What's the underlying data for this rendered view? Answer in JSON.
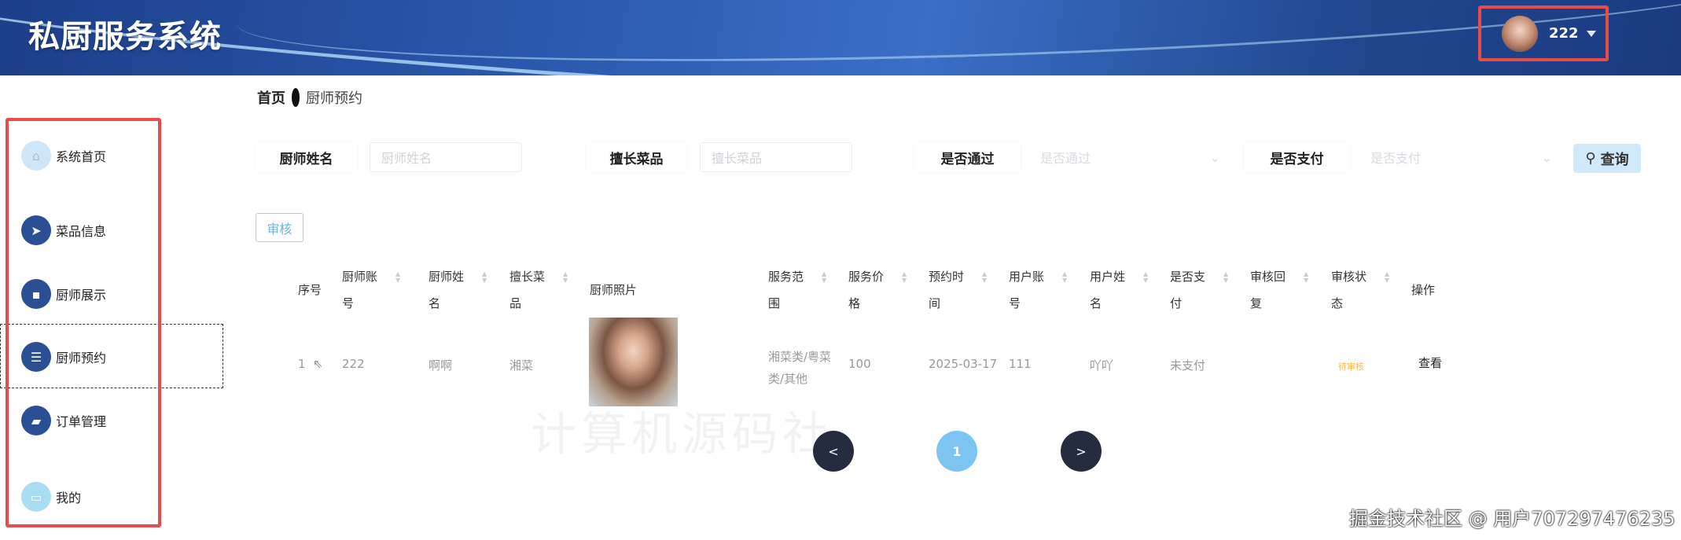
{
  "header": {
    "title": "私厨服务系统",
    "username": "222"
  },
  "breadcrumb": {
    "home": "首页",
    "current": "厨师预约"
  },
  "sidebar": {
    "items": [
      {
        "label": "系统首页",
        "icon": "home-icon"
      },
      {
        "label": "菜品信息",
        "icon": "send-icon"
      },
      {
        "label": "厨师展示",
        "icon": "chat-icon"
      },
      {
        "label": "厨师预约",
        "icon": "list-icon"
      },
      {
        "label": "订单管理",
        "icon": "briefcase-icon"
      },
      {
        "label": "我的",
        "icon": "card-icon"
      }
    ]
  },
  "search": {
    "chef_name_label": "厨师姓名",
    "chef_name_placeholder": "厨师姓名",
    "specialty_label": "擅长菜品",
    "specialty_placeholder": "擅长菜品",
    "approved_label": "是否通过",
    "approved_placeholder": "是否通过",
    "paid_label": "是否支付",
    "paid_placeholder": "是否支付",
    "query_label": "查询"
  },
  "actions": {
    "audit_label": "审核"
  },
  "table": {
    "headers": [
      "序号",
      "厨师账号",
      "厨师姓名",
      "擅长菜品",
      "厨师照片",
      "服务范围",
      "服务价格",
      "预约时间",
      "用户账号",
      "用户姓名",
      "是否支付",
      "审核回复",
      "审核状态",
      "操作"
    ],
    "rows": [
      {
        "index": "1",
        "chef_account": "222",
        "chef_name": "啊啊",
        "specialty": "湘菜",
        "service_scope": "湘菜类/粤菜类/其他",
        "price": "100",
        "time": "2025-03-17",
        "user_account": "111",
        "user_name": "吖吖",
        "paid": "未支付",
        "reply": "",
        "status": "待审核",
        "action": "查看"
      }
    ]
  },
  "pagination": {
    "prev": "<",
    "current": "1",
    "next": ">"
  },
  "watermark": "计算机源码社",
  "credit": "掘金技术社区 @ 用户707297476235",
  "colors": {
    "header": "#2c5bb0",
    "accent": "#2b4f94",
    "highlight": "#e84b4b",
    "status_pending": "#f5b94a"
  }
}
